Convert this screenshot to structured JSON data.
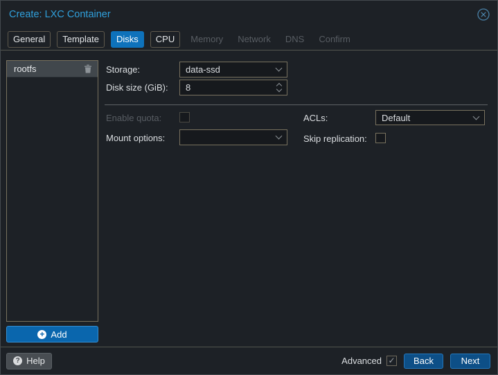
{
  "window": {
    "title": "Create: LXC Container"
  },
  "tabs": [
    {
      "label": "General",
      "state": "enabled"
    },
    {
      "label": "Template",
      "state": "enabled"
    },
    {
      "label": "Disks",
      "state": "active"
    },
    {
      "label": "CPU",
      "state": "enabled"
    },
    {
      "label": "Memory",
      "state": "disabled"
    },
    {
      "label": "Network",
      "state": "disabled"
    },
    {
      "label": "DNS",
      "state": "disabled"
    },
    {
      "label": "Confirm",
      "state": "disabled"
    }
  ],
  "mountpoints": {
    "items": [
      {
        "label": "rootfs",
        "selected": true
      }
    ],
    "add_label": "Add"
  },
  "form": {
    "storage_label": "Storage:",
    "storage_value": "data-ssd",
    "disk_size_label": "Disk size (GiB):",
    "disk_size_value": "8",
    "enable_quota_label": "Enable quota:",
    "enable_quota_checked": false,
    "enable_quota_disabled": true,
    "mount_options_label": "Mount options:",
    "mount_options_value": "",
    "acls_label": "ACLs:",
    "acls_value": "Default",
    "skip_replication_label": "Skip replication:",
    "skip_replication_checked": false
  },
  "footer": {
    "help_label": "Help",
    "advanced_label": "Advanced",
    "advanced_checked": true,
    "advanced_check_glyph": "✓",
    "back_label": "Back",
    "next_label": "Next"
  },
  "icons": {
    "plus_glyph": "+",
    "question_glyph": "?"
  },
  "colors": {
    "dialog_bg": "#1d2126",
    "title_blue": "#30a0dc",
    "tab_active_blue": "#0e72bb",
    "add_button_blue": "#0a66ad",
    "nav_button_blue": "#0d4f87",
    "input_border_tan": "#79725f",
    "selected_row": "#41474c",
    "text": "#dcdfe2",
    "disabled_text": "#585d63"
  }
}
